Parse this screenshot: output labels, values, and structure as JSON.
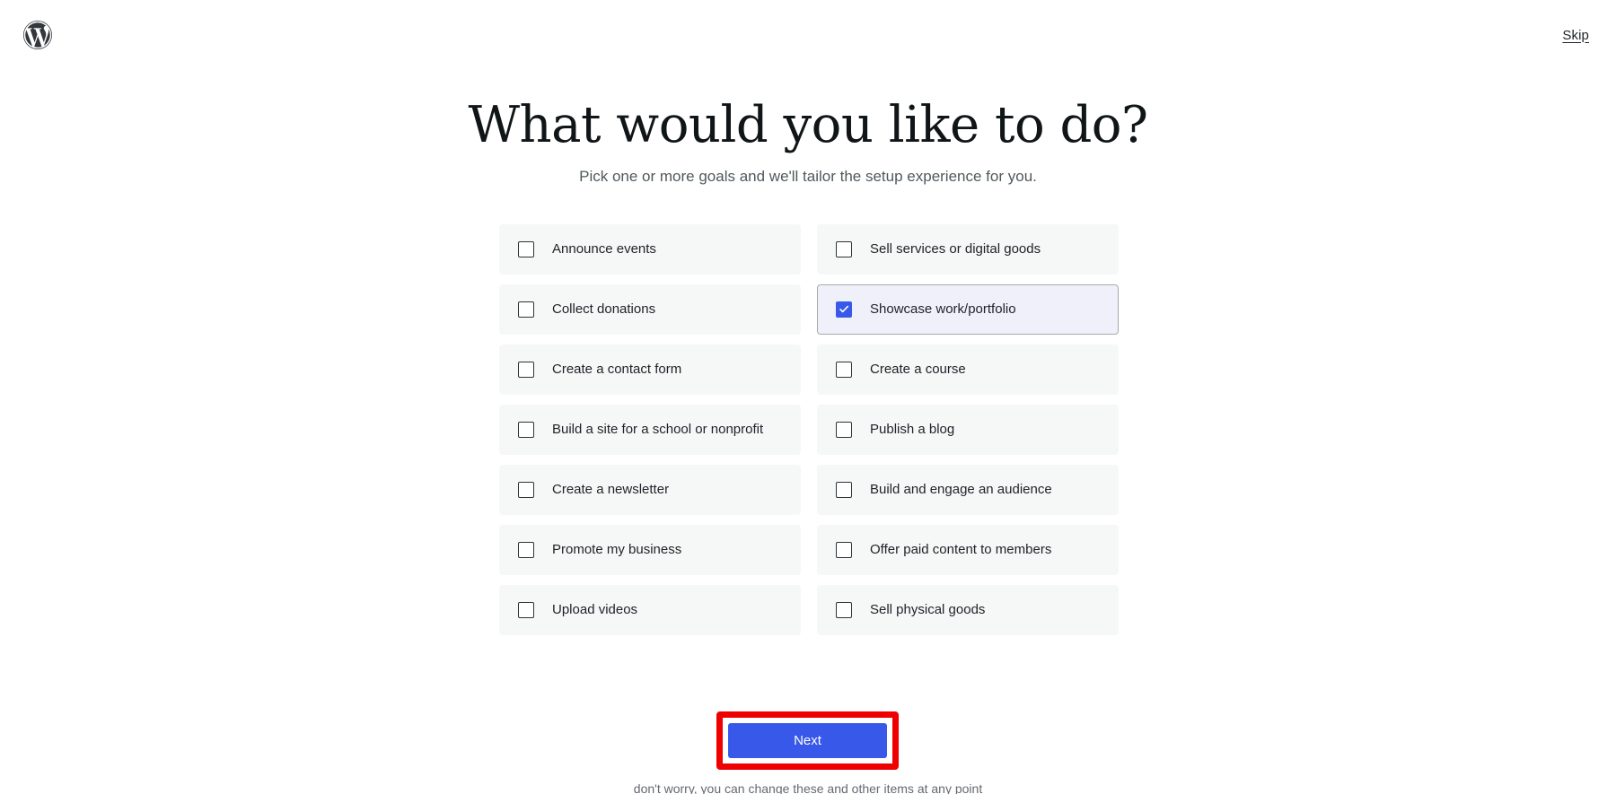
{
  "header": {
    "logo_icon": "wordpress-logo-icon",
    "skip_label": "Skip"
  },
  "main": {
    "title": "What would you like to do?",
    "subtitle": "Pick one or more goals and we'll tailor the setup experience for you.",
    "footnote": "don't worry, you can change these and other items at any point",
    "goals": [
      {
        "label": "Announce events",
        "selected": false
      },
      {
        "label": "Sell services or digital goods",
        "selected": false
      },
      {
        "label": "Collect donations",
        "selected": false
      },
      {
        "label": "Showcase work/portfolio",
        "selected": true
      },
      {
        "label": "Create a contact form",
        "selected": false
      },
      {
        "label": "Create a course",
        "selected": false
      },
      {
        "label": "Build a site for a school or nonprofit",
        "selected": false
      },
      {
        "label": "Publish a blog",
        "selected": false
      },
      {
        "label": "Create a newsletter",
        "selected": false
      },
      {
        "label": "Build and engage an audience",
        "selected": false
      },
      {
        "label": "Promote my business",
        "selected": false
      },
      {
        "label": "Offer paid content to members",
        "selected": false
      },
      {
        "label": "Upload videos",
        "selected": false
      },
      {
        "label": "Sell physical goods",
        "selected": false
      }
    ]
  },
  "footer": {
    "next_label": "Next"
  },
  "colors": {
    "accent_blue": "#3858e9",
    "card_background": "#f6f7f7",
    "selected_background": "#f0f0fb",
    "annotation_red": "#ee0000",
    "text_primary": "#1d2327",
    "text_muted": "#51585c"
  }
}
